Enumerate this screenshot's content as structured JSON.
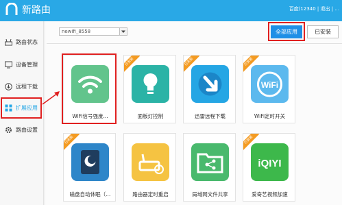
{
  "header": {
    "app_title": "新路由",
    "account_text": "百度(12340 | 退出 | ...",
    "colors": {
      "bar": "#29a8e6",
      "accent": "#1f8fe6",
      "highlight": "#e02020",
      "installed_ribbon": "#f49b22"
    }
  },
  "sidebar": {
    "items": [
      {
        "label": "路由状态",
        "icon": "router-icon",
        "active": false
      },
      {
        "label": "设备管理",
        "icon": "monitor-icon",
        "active": false
      },
      {
        "label": "远程下载",
        "icon": "download-icon",
        "active": false
      },
      {
        "label": "扩展应用",
        "icon": "extend-apps-icon",
        "active": true
      },
      {
        "label": "路由设置",
        "icon": "gear-icon",
        "active": false
      }
    ]
  },
  "toolbar": {
    "router_select_value": "newifi_8558",
    "tab_all": "全部应用",
    "tab_installed": "已安装"
  },
  "apps": [
    {
      "name": "WiFi信号强度...",
      "installed": false,
      "icon": "wifi-signal-icon",
      "color": "#62c48c"
    },
    {
      "name": "面板灯控制",
      "installed": true,
      "icon": "light-bulb-icon",
      "color": "#2bb3a6"
    },
    {
      "name": "迅雷远程下载",
      "installed": true,
      "icon": "thunder-download-icon",
      "color": "#25a6e4"
    },
    {
      "name": "WiFi定时开关",
      "installed": true,
      "icon": "wifi-timer-icon",
      "color": "#5cb9ee"
    },
    {
      "name": "磁盘自动休眠（...",
      "installed": true,
      "icon": "disk-sleep-icon",
      "color": "#2e86c9"
    },
    {
      "name": "路由器定时重启",
      "installed": false,
      "icon": "router-reboot-icon",
      "color": "#f5c342"
    },
    {
      "name": "局域网文件共享",
      "installed": false,
      "icon": "folder-share-icon",
      "color": "#49b96d"
    },
    {
      "name": "爱奇艺视频加速",
      "installed": true,
      "icon": "iqiyi-icon",
      "color": "#3db84b"
    }
  ],
  "ribbon_text": "已安装"
}
